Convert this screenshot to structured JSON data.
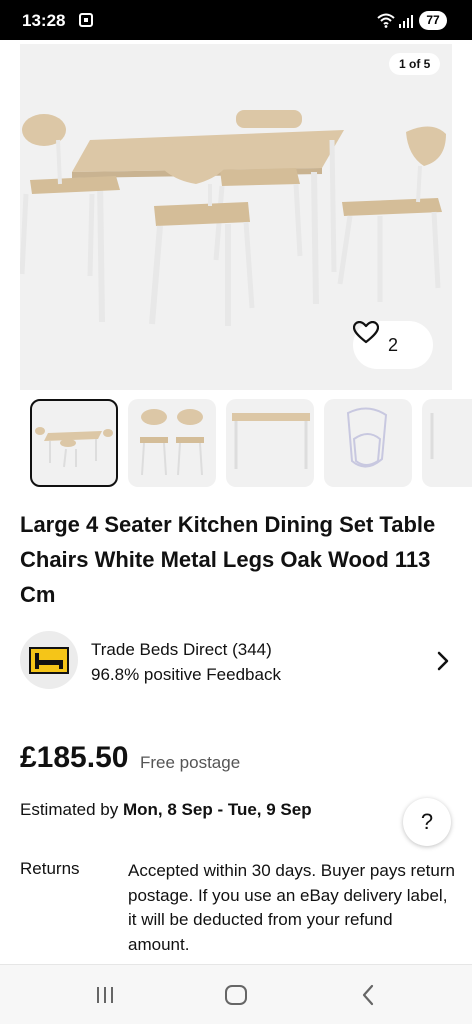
{
  "status_bar": {
    "time": "13:28",
    "battery": "77"
  },
  "gallery": {
    "counter": "1 of 5",
    "watch_count": "2",
    "icons": {
      "watch": "heart-icon"
    }
  },
  "listing": {
    "title": "Large 4 Seater Kitchen Dining Set Table Chairs White Metal Legs Oak Wood 113 Cm"
  },
  "seller": {
    "name": "Trade Beds Direct (344)",
    "feedback": "96.8% positive Feedback",
    "logo_color": "#f5c518"
  },
  "pricing": {
    "price": "£185.50",
    "postage": "Free postage"
  },
  "delivery": {
    "estimated_prefix": "Estimated by",
    "estimated_range": "Mon, 8 Sep - Tue, 9 Sep",
    "help_label": "?"
  },
  "returns": {
    "label": "Returns",
    "text": "Accepted within 30 days. Buyer pays return postage. If you use an eBay delivery label, it will be deducted from your refund amount."
  }
}
